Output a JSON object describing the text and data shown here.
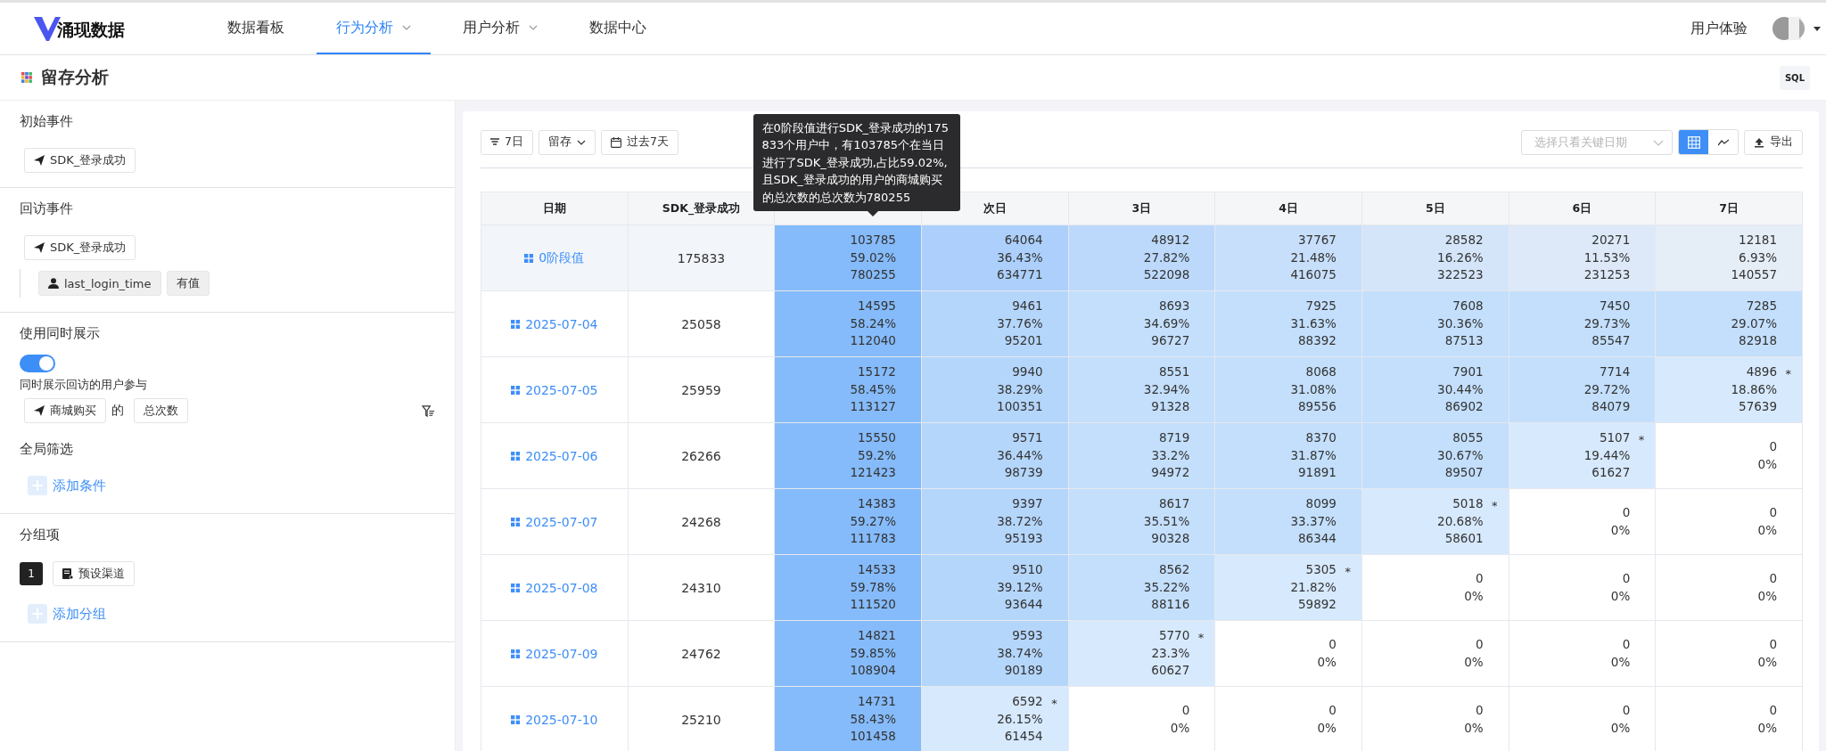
{
  "nav": {
    "logo": "涌现**数据**",
    "items": [
      {
        "label": "数据看板",
        "selected": false,
        "dropdown": false
      },
      {
        "label": "行为分析",
        "selected": true,
        "dropdown": true
      },
      {
        "label": "用户分析",
        "selected": false,
        "dropdown": true
      },
      {
        "label": "数据中心",
        "selected": false,
        "dropdown": false
      }
    ],
    "user_label": "用户体验"
  },
  "page": {
    "title": "留存分析",
    "sql_button": "SQL"
  },
  "sidebar": {
    "initial_event": {
      "title": "初始事件",
      "event": "SDK_登录成功"
    },
    "return_event": {
      "title": "回访事件",
      "event": "SDK_登录成功",
      "filter": {
        "property": "last_login_time",
        "condition": "有值"
      }
    },
    "show_together": {
      "title": "使用同时展示",
      "on": true,
      "caption": "同时展示回访的用户参与",
      "event": "商城购买",
      "joiner": "的",
      "metric": "总次数"
    },
    "global_filter": {
      "title": "全局筛选",
      "add": "添加条件"
    },
    "grouping": {
      "title": "分组项",
      "items": [
        {
          "index": "1",
          "label": "预设渠道"
        }
      ],
      "add": "添加分组"
    }
  },
  "toolbar": {
    "period": "7日",
    "mode": "留存",
    "range": "过去7天",
    "date_select": {
      "placeholder": "选择只看关键日期"
    },
    "views": [
      {
        "kind": "table",
        "selected": true
      },
      {
        "kind": "line",
        "selected": false
      }
    ],
    "export": "导出"
  },
  "tooltip": {
    "text": "在0阶段值进行SDK_登录成功的175833个用户中，有103785个在当日进行了SDK_登录成功,占比59.02%,且SDK_登录成功的用户的商城购买的总次数的总次数为780255"
  },
  "table": {
    "columns": [
      "日期",
      "SDK_登录成功",
      "",
      "次日",
      "3日",
      "4日",
      "5日",
      "6日",
      "7日"
    ],
    "rows": [
      {
        "kind": "summary",
        "cells": [
          {
            "text": "0阶段值"
          },
          {
            "text": "175833"
          },
          {
            "lines": [
              "103785",
              "59.02%",
              "780255"
            ],
            "color": "#85bbfa"
          },
          {
            "lines": [
              "64064",
              "36.43%",
              "634771"
            ],
            "color": "#acd0fb"
          },
          {
            "lines": [
              "48912",
              "27.82%",
              "522098"
            ],
            "color": "#bcd9fb"
          },
          {
            "lines": [
              "37767",
              "21.48%",
              "416075"
            ],
            "color": "#c7dffa"
          },
          {
            "lines": [
              "28582",
              "16.26%",
              "322523"
            ],
            "color": "#d4e5f9"
          },
          {
            "lines": [
              "20271",
              "11.53%",
              "231253"
            ],
            "color": "#dde9f8"
          },
          {
            "lines": [
              "12181",
              "6.93%",
              "140557"
            ],
            "color": "#e5edf7"
          }
        ]
      },
      {
        "kind": "date",
        "cells": [
          {
            "text": "2025-07-04"
          },
          {
            "text": "25058"
          },
          {
            "lines": [
              "14595",
              "58.24%",
              "112040"
            ],
            "color": "#85bbfa"
          },
          {
            "lines": [
              "9461",
              "37.76%",
              "95201"
            ],
            "color": "#b5d6fb"
          },
          {
            "lines": [
              "8693",
              "34.69%",
              "96727"
            ],
            "color": "#c3dffc"
          },
          {
            "lines": [
              "7925",
              "31.63%",
              "88392"
            ],
            "color": "#c3dffc"
          },
          {
            "lines": [
              "7608",
              "30.36%",
              "87513"
            ],
            "color": "#c3dffc"
          },
          {
            "lines": [
              "7450",
              "29.73%",
              "85547"
            ],
            "color": "#c3dffc"
          },
          {
            "lines": [
              "7285",
              "29.07%",
              "82918"
            ],
            "color": "#c3dffc"
          }
        ]
      },
      {
        "kind": "date",
        "cells": [
          {
            "text": "2025-07-05"
          },
          {
            "text": "25959"
          },
          {
            "lines": [
              "15172",
              "58.45%",
              "113127"
            ],
            "color": "#85bbfa"
          },
          {
            "lines": [
              "9940",
              "38.29%",
              "100351"
            ],
            "color": "#b5d6fb"
          },
          {
            "lines": [
              "8551",
              "32.94%",
              "91328"
            ],
            "color": "#c3dffc"
          },
          {
            "lines": [
              "8068",
              "31.08%",
              "89556"
            ],
            "color": "#c3dffc"
          },
          {
            "lines": [
              "7901",
              "30.44%",
              "86902"
            ],
            "color": "#c3dffc"
          },
          {
            "lines": [
              "7714",
              "29.72%",
              "84079"
            ],
            "color": "#c3dffc"
          },
          {
            "lines": [
              "4896",
              "18.86%",
              "57639"
            ],
            "mark": "*",
            "color": "#d7e9fd"
          }
        ]
      },
      {
        "kind": "date",
        "cells": [
          {
            "text": "2025-07-06"
          },
          {
            "text": "26266"
          },
          {
            "lines": [
              "15550",
              "59.2%",
              "121423"
            ],
            "color": "#85bbfa"
          },
          {
            "lines": [
              "9571",
              "36.44%",
              "98739"
            ],
            "color": "#b5d6fb"
          },
          {
            "lines": [
              "8719",
              "33.2%",
              "94972"
            ],
            "color": "#c3dffc"
          },
          {
            "lines": [
              "8370",
              "31.87%",
              "91891"
            ],
            "color": "#c3dffc"
          },
          {
            "lines": [
              "8055",
              "30.67%",
              "89507"
            ],
            "color": "#c3dffc"
          },
          {
            "lines": [
              "5107",
              "19.44%",
              "61627"
            ],
            "mark": "*",
            "color": "#d7e9fd"
          },
          {
            "lines": [
              "0",
              "0%"
            ]
          }
        ]
      },
      {
        "kind": "date",
        "cells": [
          {
            "text": "2025-07-07"
          },
          {
            "text": "24268"
          },
          {
            "lines": [
              "14383",
              "59.27%",
              "111783"
            ],
            "color": "#85bbfa"
          },
          {
            "lines": [
              "9397",
              "38.72%",
              "95193"
            ],
            "color": "#b5d6fb"
          },
          {
            "lines": [
              "8617",
              "35.51%",
              "90328"
            ],
            "color": "#c3dffc"
          },
          {
            "lines": [
              "8099",
              "33.37%",
              "86344"
            ],
            "color": "#c3dffc"
          },
          {
            "lines": [
              "5018",
              "20.68%",
              "58601"
            ],
            "mark": "*",
            "color": "#d7e9fd"
          },
          {
            "lines": [
              "0",
              "0%"
            ]
          },
          {
            "lines": [
              "0",
              "0%"
            ]
          }
        ]
      },
      {
        "kind": "date",
        "cells": [
          {
            "text": "2025-07-08"
          },
          {
            "text": "24310"
          },
          {
            "lines": [
              "14533",
              "59.78%",
              "111520"
            ],
            "color": "#85bbfa"
          },
          {
            "lines": [
              "9510",
              "39.12%",
              "93644"
            ],
            "color": "#b5d6fb"
          },
          {
            "lines": [
              "8562",
              "35.22%",
              "88116"
            ],
            "color": "#c3dffc"
          },
          {
            "lines": [
              "5305",
              "21.82%",
              "59892"
            ],
            "mark": "*",
            "color": "#d7e9fd"
          },
          {
            "lines": [
              "0",
              "0%"
            ]
          },
          {
            "lines": [
              "0",
              "0%"
            ]
          },
          {
            "lines": [
              "0",
              "0%"
            ]
          }
        ]
      },
      {
        "kind": "date",
        "cells": [
          {
            "text": "2025-07-09"
          },
          {
            "text": "24762"
          },
          {
            "lines": [
              "14821",
              "59.85%",
              "108904"
            ],
            "color": "#85bbfa"
          },
          {
            "lines": [
              "9593",
              "38.74%",
              "90189"
            ],
            "color": "#b5d6fb"
          },
          {
            "lines": [
              "5770",
              "23.3%",
              "60627"
            ],
            "mark": "*",
            "color": "#d7e9fd"
          },
          {
            "lines": [
              "0",
              "0%"
            ]
          },
          {
            "lines": [
              "0",
              "0%"
            ]
          },
          {
            "lines": [
              "0",
              "0%"
            ]
          },
          {
            "lines": [
              "0",
              "0%"
            ]
          }
        ]
      },
      {
        "kind": "date",
        "cells": [
          {
            "text": "2025-07-10"
          },
          {
            "text": "25210"
          },
          {
            "lines": [
              "14731",
              "58.43%",
              "101458"
            ],
            "color": "#85bbfa"
          },
          {
            "lines": [
              "6592",
              "26.15%",
              "61454"
            ],
            "mark": "*",
            "color": "#d7e9fd"
          },
          {
            "lines": [
              "0",
              "0%"
            ]
          },
          {
            "lines": [
              "0",
              "0%"
            ]
          },
          {
            "lines": [
              "0",
              "0%"
            ]
          },
          {
            "lines": [
              "0",
              "0%"
            ]
          },
          {
            "lines": [
              "0",
              "0%"
            ]
          }
        ]
      }
    ]
  }
}
